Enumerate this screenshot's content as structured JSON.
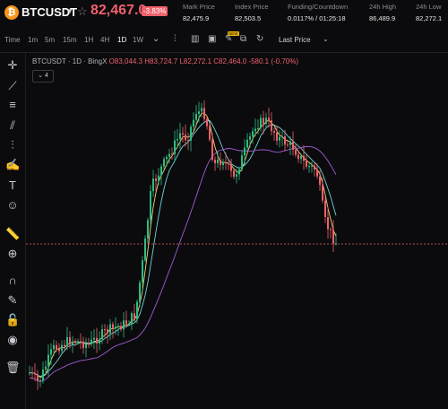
{
  "header": {
    "symbol": "BTCUSDT",
    "last_price": "82,467.0",
    "change_pct": "-3.83%",
    "stats": [
      {
        "label": "Mark Price",
        "value": "82,475.9"
      },
      {
        "label": "Index Price",
        "value": "82,503.5"
      },
      {
        "label": "Funding/Countdown",
        "value": "0.0117% / 01:25:18"
      },
      {
        "label": "24h High",
        "value": "86,489.9"
      },
      {
        "label": "24h Low",
        "value": "82,272.1"
      }
    ]
  },
  "toolbar": {
    "time_label": "Time",
    "intervals": [
      "1m",
      "5m",
      "15m",
      "1H",
      "4H",
      "1D",
      "1W"
    ],
    "active_interval": "1D",
    "new_badge": "NEW",
    "price_type": "Last Price"
  },
  "chart": {
    "title": "BTCUSDT · 1D · BingX",
    "ohlc": {
      "o": "O83,044.3",
      "h": "H83,724.7",
      "l": "L82,272.1",
      "c": "C82,464.0",
      "chg": "-580.1 (-0.70%)"
    },
    "indicator_count": "4",
    "colors": {
      "up": "#2ebd85",
      "down": "#f0616d",
      "ma_fast": "#f5d36a",
      "ma_mid": "#6fd3d8",
      "ma_slow": "#a35cd6"
    }
  }
}
